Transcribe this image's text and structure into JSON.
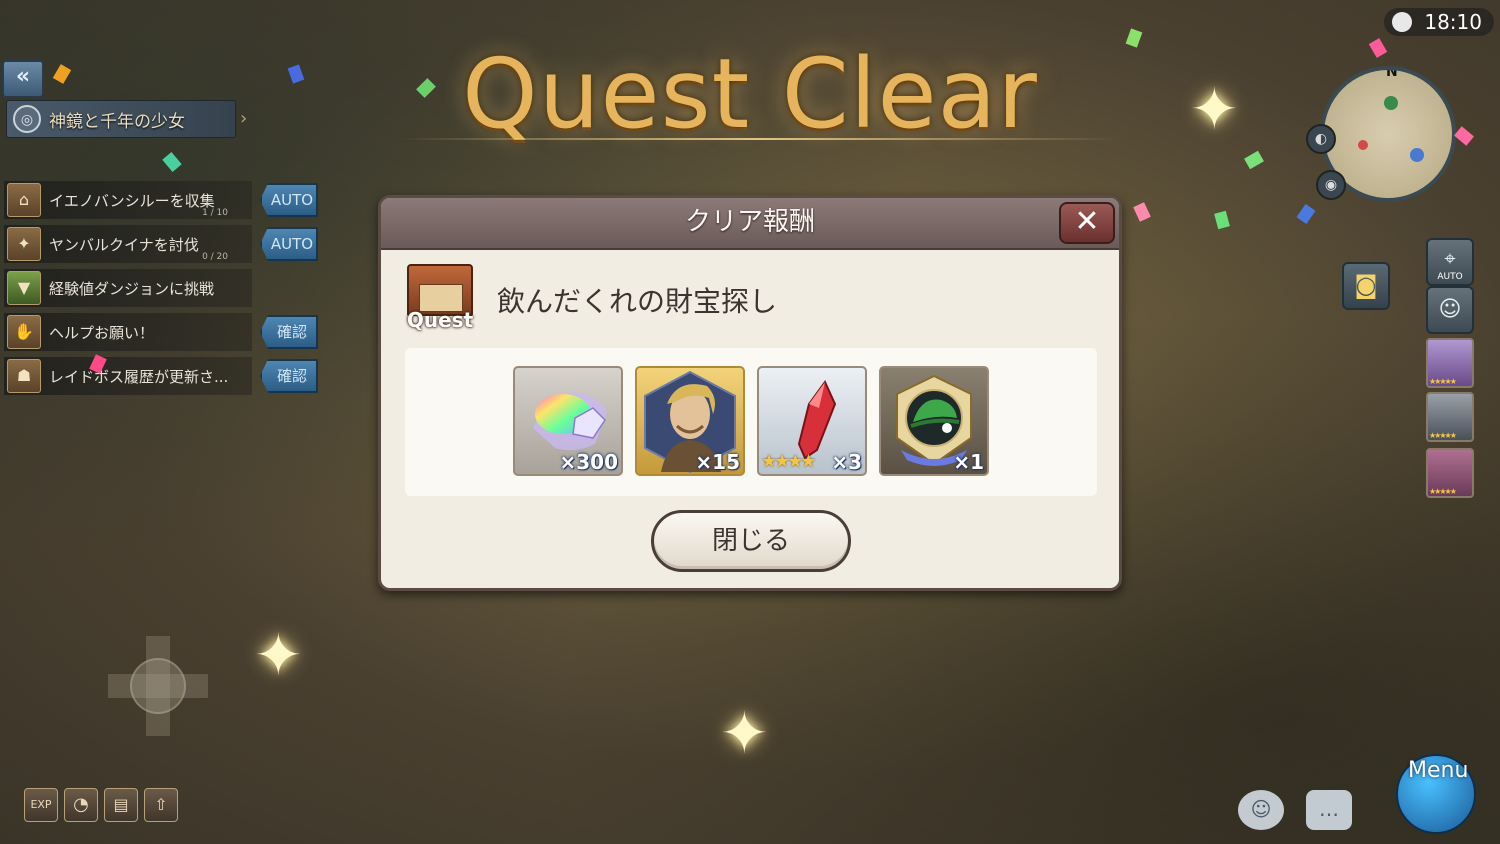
{
  "hud": {
    "back_label": "«",
    "story_title": "神鏡と千年の少女",
    "story_icon": "emblem-icon",
    "clock": "18:10",
    "minimap_north": "N",
    "auto_label": "AUTO",
    "menu_label": "Menu",
    "exp_label": "EXP"
  },
  "quests": [
    {
      "text": "イエノバンシルーを収集",
      "progress": "1 / 10",
      "action": "AUTO"
    },
    {
      "text": "ヤンバルクイナを討伐",
      "progress": "0 / 20",
      "action": "AUTO"
    },
    {
      "text": "経験値ダンジョンに挑戦",
      "progress": "",
      "action": ""
    },
    {
      "text": "ヘルプお願い！",
      "progress": "",
      "action": "確認"
    },
    {
      "text": "レイドボス履歴が更新さ...",
      "progress": "",
      "action": "確認"
    }
  ],
  "banner": {
    "title": "Quest Clear"
  },
  "dialog": {
    "header": "クリア報酬",
    "badge_label": "Quest",
    "quest_name": "飲んだくれの財宝探し",
    "rewards": [
      {
        "name": "rainbow-crystal",
        "count": "×300",
        "stars": ""
      },
      {
        "name": "character-portrait",
        "count": "×15",
        "stars": ""
      },
      {
        "name": "red-crystal-shard",
        "count": "×3",
        "stars": "★★★★"
      },
      {
        "name": "green-hat-emblem",
        "count": "×1",
        "stars": ""
      }
    ],
    "close_label": "閉じる"
  },
  "colors": {
    "title_gold": "#e6b45c",
    "dialog_bg": "#f2ede3",
    "header_bg": "#7a6a68",
    "auto_blue": "#3f76a2"
  }
}
